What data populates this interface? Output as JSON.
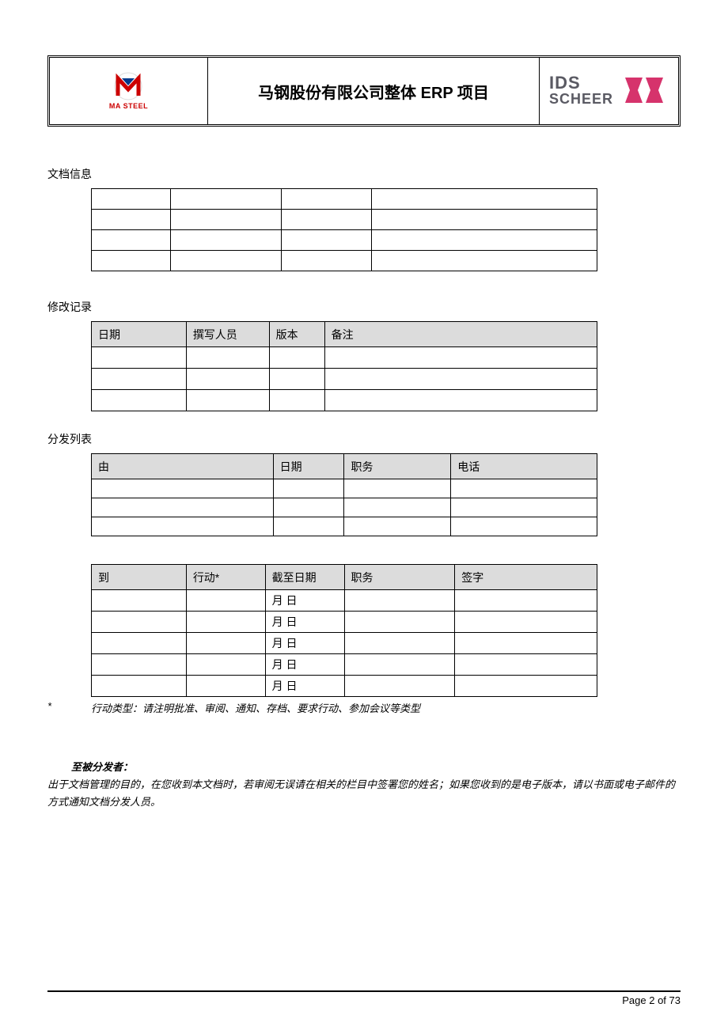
{
  "header": {
    "title": "马钢股份有限公司整体 ERP 项目",
    "logo_left_text": "MA STEEL",
    "logo_right_ids": "IDS",
    "logo_right_scheer": "SCHEER"
  },
  "sections": {
    "doc_info_title": "文档信息",
    "revision_title": "修改记录",
    "distribution_title": "分发列表"
  },
  "revision_table": {
    "h1": "日期",
    "h2": "撰写人员",
    "h3": "版本",
    "h4": "备注"
  },
  "dist_table_1": {
    "h1": "由",
    "h2": "日期",
    "h3": "职务",
    "h4": "电话"
  },
  "dist_table_2": {
    "h1": "到",
    "h2": "行动*",
    "h3": "截至日期",
    "h4": "职务",
    "h5": "签字",
    "date_placeholder": "月 日"
  },
  "footnote": {
    "star": "*",
    "text": "行动类型：请注明批准、审阅、通知、存档、要求行动、参加会议等类型"
  },
  "notice": {
    "heading": "至被分发者：",
    "body": "出于文档管理的目的，在您收到本文档时，若审阅无误请在相关的栏目中签署您的姓名；如果您收到的是电子版本，请以书面或电子邮件的方式通知文档分发人员。"
  },
  "footer": {
    "page_label": "Page 2 of 73"
  }
}
